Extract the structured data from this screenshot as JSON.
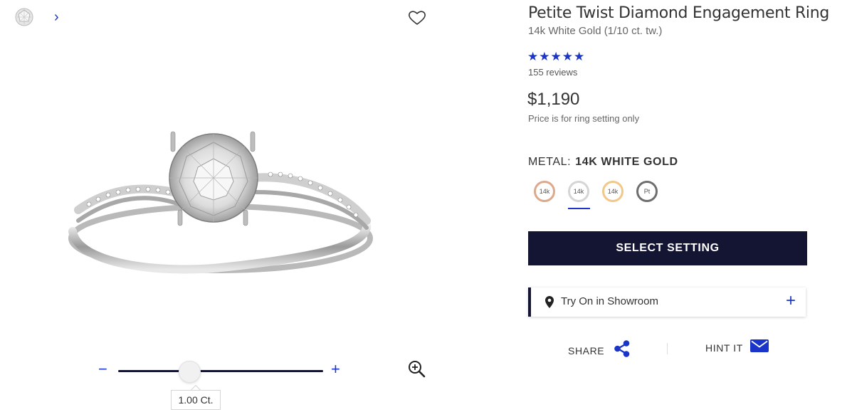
{
  "gallery": {
    "next_label": "›",
    "zoom_icon": "zoom-in-icon",
    "wishlist_icon": "heart-icon"
  },
  "carat_slider": {
    "minus_label": "−",
    "plus_label": "+",
    "value_label": "1.00 Ct.",
    "position_fraction": 0.35
  },
  "product": {
    "title": "Petite Twist Diamond Engagement Ring",
    "subtitle": "14k White Gold (1/10 ct. tw.)",
    "rating_stars": "★★★★★",
    "rating_value": 5,
    "reviews": "155 reviews",
    "price": "$1,190",
    "price_note": "Price is for ring setting only"
  },
  "metal": {
    "label": "METAL:",
    "selected": "14K WHITE GOLD",
    "options": [
      {
        "label": "14k",
        "color": "#dca98c"
      },
      {
        "label": "14k",
        "color": "#d5d5d5"
      },
      {
        "label": "14k",
        "color": "#f1c78a"
      },
      {
        "label": "Pt",
        "color": "#6e6e6e"
      }
    ]
  },
  "actions": {
    "select_setting": "SELECT SETTING",
    "try_on": "Try On in Showroom",
    "try_on_expand": "+",
    "share": "SHARE",
    "hint": "HINT IT"
  },
  "colors": {
    "accent": "#1a35c8",
    "navy": "#141433"
  }
}
